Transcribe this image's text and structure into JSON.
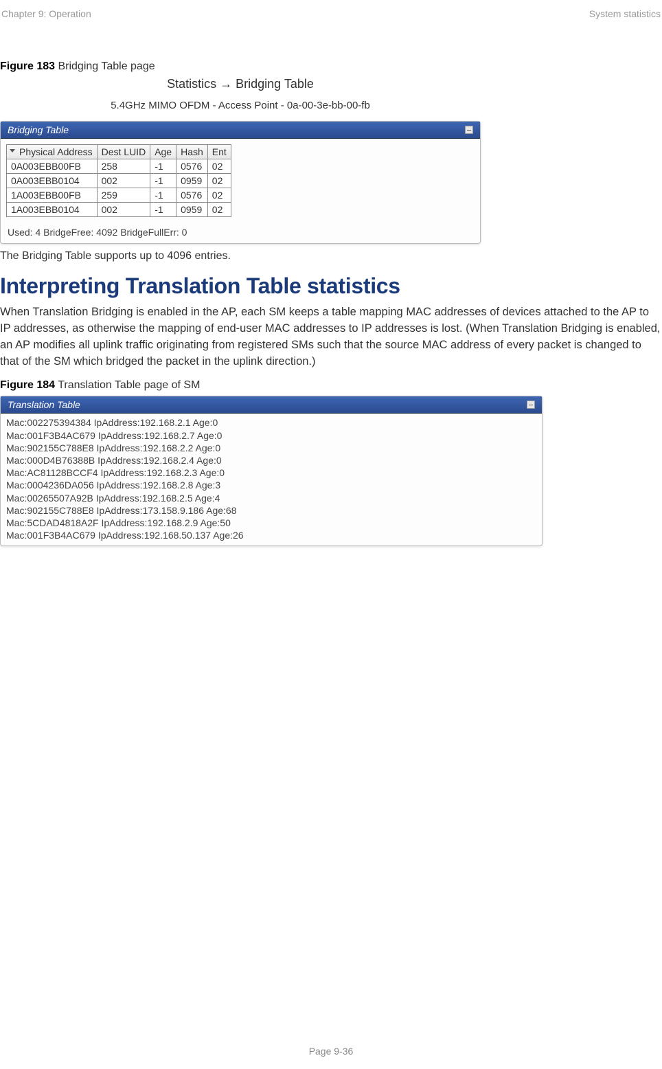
{
  "header": {
    "left": "Chapter 9:  Operation",
    "right": "System statistics"
  },
  "figure183": {
    "label_bold": "Figure 183",
    "label_rest": " Bridging Table page",
    "panel_title": "Statistics → Bridging Table",
    "panel_subtitle": "5.4GHz MIMO OFDM - Access Point - 0a-00-3e-bb-00-fb",
    "panel_header": "Bridging Table",
    "columns": {
      "c0": "Physical Address",
      "c1": "Dest LUID",
      "c2": "Age",
      "c3": "Hash",
      "c4": "Ent"
    },
    "rows": [
      {
        "c0": "0A003EBB00FB",
        "c1": "258",
        "c2": "-1",
        "c3": "0576",
        "c4": "02"
      },
      {
        "c0": "0A003EBB0104",
        "c1": "002",
        "c2": "-1",
        "c3": "0959",
        "c4": "02"
      },
      {
        "c0": "1A003EBB00FB",
        "c1": "259",
        "c2": "-1",
        "c3": "0576",
        "c4": "02"
      },
      {
        "c0": "1A003EBB0104",
        "c1": "002",
        "c2": "-1",
        "c3": "0959",
        "c4": "02"
      }
    ],
    "footer": "Used: 4 BridgeFree: 4092 BridgeFullErr: 0"
  },
  "text1": "The Bridging Table supports up to 4096 entries.",
  "heading": "Interpreting Translation Table statistics",
  "paragraph": "When Translation Bridging is enabled in the AP, each SM keeps a table mapping MAC addresses of devices attached to the AP to IP addresses, as otherwise the mapping of end-user MAC addresses to IP addresses is lost. (When Translation Bridging is enabled, an AP modifies all uplink traffic originating from registered SMs such that the source MAC address of every packet is changed to that of the SM which bridged the packet in the uplink direction.)",
  "figure184": {
    "label_bold": "Figure 184",
    "label_rest": " Translation Table page of SM",
    "panel_header": "Translation Table",
    "lines": [
      "Mac:002275394384 IpAddress:192.168.2.1 Age:0",
      "Mac:001F3B4AC679 IpAddress:192.168.2.7 Age:0",
      "Mac:902155C788E8 IpAddress:192.168.2.2 Age:0",
      "Mac:000D4B76388B IpAddress:192.168.2.4 Age:0",
      "Mac:AC81128BCCF4 IpAddress:192.168.2.3 Age:0",
      "Mac:0004236DA056 IpAddress:192.168.2.8 Age:3",
      "Mac:00265507A92B IpAddress:192.168.2.5 Age:4",
      "Mac:902155C788E8 IpAddress:173.158.9.186 Age:68",
      "Mac:5CDAD4818A2F IpAddress:192.168.2.9 Age:50",
      "Mac:001F3B4AC679 IpAddress:192.168.50.137 Age:26"
    ]
  },
  "pagenum": "Page 9-36"
}
